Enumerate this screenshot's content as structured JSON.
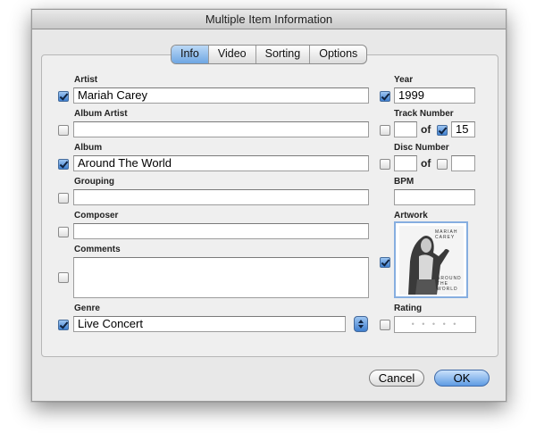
{
  "window": {
    "title": "Multiple Item Information"
  },
  "tabs": [
    "Info",
    "Video",
    "Sorting",
    "Options"
  ],
  "fields": {
    "artist": {
      "label": "Artist",
      "value": "Mariah Carey",
      "checked": true
    },
    "album_artist": {
      "label": "Album Artist",
      "value": "",
      "checked": false
    },
    "album": {
      "label": "Album",
      "value": "Around The World",
      "checked": true
    },
    "grouping": {
      "label": "Grouping",
      "value": "",
      "checked": false
    },
    "composer": {
      "label": "Composer",
      "value": "",
      "checked": false
    },
    "comments": {
      "label": "Comments",
      "value": "",
      "checked": false
    },
    "genre": {
      "label": "Genre",
      "value": "Live Concert",
      "checked": true
    },
    "year": {
      "label": "Year",
      "value": "1999",
      "checked": true
    },
    "track_number": {
      "label": "Track Number",
      "value": "",
      "of_label": "of",
      "total": "15",
      "checked": false,
      "total_checked": true
    },
    "disc_number": {
      "label": "Disc Number",
      "value": "",
      "of_label": "of",
      "total": "",
      "checked": false,
      "total_checked": false
    },
    "bpm": {
      "label": "BPM",
      "value": ""
    },
    "artwork": {
      "label": "Artwork",
      "checked": true,
      "caption_top": "MARIAH CAREY",
      "caption_bottom": "AROUND THE WORLD"
    },
    "rating": {
      "label": "Rating",
      "value": 0,
      "placeholder_dots": "• • • • •",
      "checked": false
    }
  },
  "buttons": {
    "cancel": "Cancel",
    "ok": "OK"
  },
  "colors": {
    "accent": "#5e9be3",
    "panel": "#efefef",
    "window": "#e8e8e8"
  }
}
